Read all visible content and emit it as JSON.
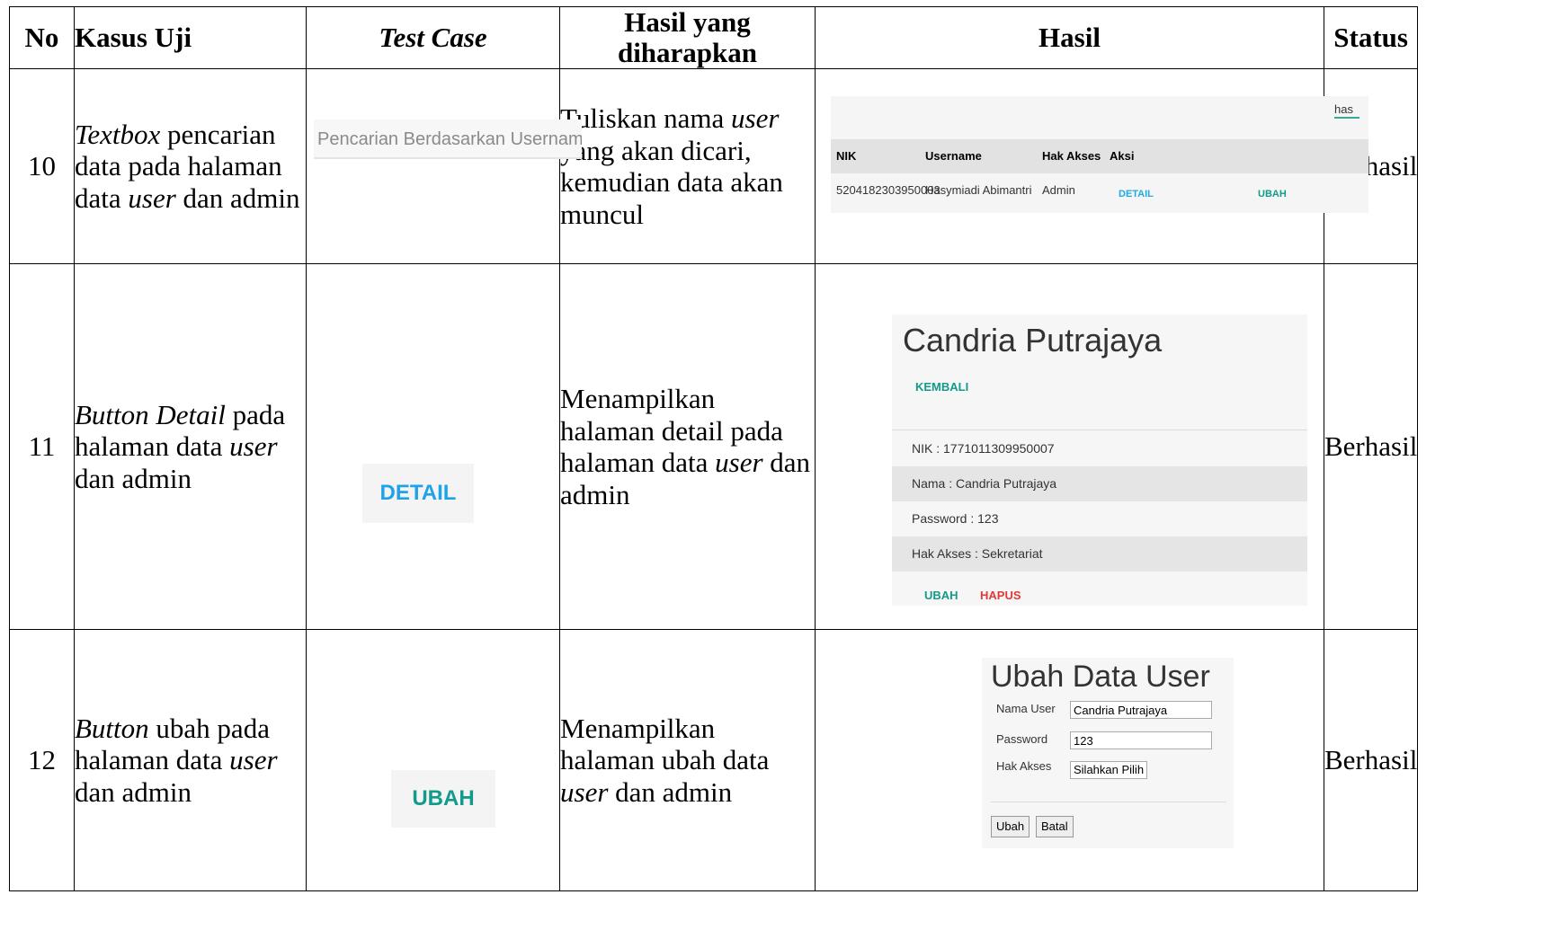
{
  "headers": {
    "no": "No",
    "case": "Kasus Uji",
    "test_case": "Test Case",
    "expected_line1": "Hasil yang",
    "expected_line2": "diharapkan",
    "result": "Hasil",
    "status": "Status"
  },
  "rows": [
    {
      "no": "10",
      "case_em1": "Textbox",
      "case_t1": " pencarian data pada halaman data ",
      "case_em2": "user",
      "case_t2": " dan admin",
      "test_placeholder": "Pencarian Berdasarkan Username",
      "exp_t1": "Tuliskan nama ",
      "exp_em": "user",
      "exp_t2": " yang akan dicari, kemudian data akan muncul",
      "status": "Berhasil",
      "shot": {
        "search_value": "has",
        "headers": [
          "NIK",
          "Username",
          "Hak Akses",
          "Aksi"
        ],
        "row": [
          "5204182303950003",
          "Hasymiadi Abimantri",
          "Admin"
        ],
        "detail": "DETAIL",
        "ubah": "UBAH"
      }
    },
    {
      "no": "11",
      "case_em1": "Button Detail",
      "case_t1": " pada halaman data ",
      "case_em2": "user",
      "case_t2": " dan admin",
      "test_button": "DETAIL",
      "exp_t1": "Menampilkan halaman detail pada halaman data ",
      "exp_em": "user",
      "exp_t2": " dan admin",
      "status": "Berhasil",
      "shot": {
        "title": "Candria Putrajaya",
        "back": "KEMBALI",
        "nik": "NIK : 1771011309950007",
        "nama": "Nama : Candria Putrajaya",
        "password": "Password : 123",
        "hak_akses": "Hak Akses : Sekretariat",
        "ubah": "UBAH",
        "hapus": "HAPUS"
      }
    },
    {
      "no": "12",
      "case_em1": "Button",
      "case_t1": " ubah pada halaman data ",
      "case_em2": "user",
      "case_t2": " dan admin",
      "test_button": "UBAH",
      "exp_t1": "Menampilkan halaman ubah data ",
      "exp_em": "user",
      "exp_t2": " dan admin",
      "status": "Berhasil",
      "shot": {
        "title": "Ubah Data User",
        "label_nama": "Nama User",
        "value_nama": "Candria Putrajaya",
        "label_password": "Password",
        "value_password": "123",
        "label_hak": "Hak Akses",
        "value_hak": "Silahkan Pilih",
        "btn_ubah": "Ubah",
        "btn_batal": "Batal"
      }
    }
  ],
  "colors": {
    "link_blue": "#1fa3e8",
    "link_teal": "#129a8a",
    "link_red": "#e53935"
  }
}
